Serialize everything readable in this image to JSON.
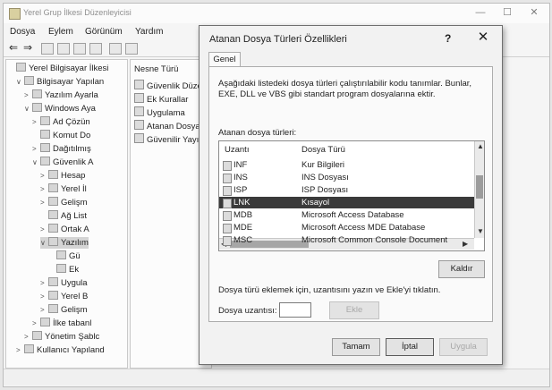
{
  "main_window": {
    "title": "Yerel Grup İlkesi Düzenleyicisi",
    "controls": {
      "minimize": "—",
      "maximize": "☐",
      "close": "✕"
    }
  },
  "menubar": [
    "Dosya",
    "Eylem",
    "Görünüm",
    "Yardım"
  ],
  "tree": [
    {
      "label": "Yerel Bilgisayar İlkesi",
      "arrow": "",
      "depth": 0
    },
    {
      "label": "Bilgisayar Yapılan",
      "arrow": "∨",
      "depth": 1
    },
    {
      "label": "Yazılım Ayarla",
      "arrow": ">",
      "depth": 2
    },
    {
      "label": "Windows Aya",
      "arrow": "∨",
      "depth": 2
    },
    {
      "label": "Ad Çözün",
      "arrow": ">",
      "depth": 3
    },
    {
      "label": "Komut Do",
      "arrow": "",
      "depth": 3
    },
    {
      "label": "Dağıtılmış",
      "arrow": ">",
      "depth": 3
    },
    {
      "label": "Güvenlik A",
      "arrow": "∨",
      "depth": 3
    },
    {
      "label": "Hesap",
      "arrow": ">",
      "depth": 4
    },
    {
      "label": "Yerel İl",
      "arrow": ">",
      "depth": 4
    },
    {
      "label": "Gelişm",
      "arrow": ">",
      "depth": 4
    },
    {
      "label": "Ağ List",
      "arrow": "",
      "depth": 4
    },
    {
      "label": "Ortak A",
      "arrow": ">",
      "depth": 4
    },
    {
      "label": "Yazılım",
      "arrow": "∨",
      "depth": 4,
      "selected": true
    },
    {
      "label": "Gü",
      "arrow": "",
      "depth": 5
    },
    {
      "label": "Ek",
      "arrow": "",
      "depth": 5
    },
    {
      "label": "Uygula",
      "arrow": ">",
      "depth": 4
    },
    {
      "label": "Yerel B",
      "arrow": ">",
      "depth": 4
    },
    {
      "label": "Gelişm",
      "arrow": ">",
      "depth": 4
    },
    {
      "label": "İlke tabanl",
      "arrow": ">",
      "depth": 3
    },
    {
      "label": "Yönetim Şablc",
      "arrow": ">",
      "depth": 2
    },
    {
      "label": "Kullanıcı Yapıland",
      "arrow": ">",
      "depth": 1
    }
  ],
  "list_pane": {
    "header": "Nesne Türü",
    "items": [
      "Güvenlik Düzey",
      "Ek Kurallar",
      "Uygulama",
      "Atanan Dosya T",
      "Güvenilir Yayın"
    ]
  },
  "dialog": {
    "title": "Atanan Dosya Türleri Özellikleri",
    "help": "?",
    "close": "✕",
    "tab": "Genel",
    "description": "Aşağıdaki listedeki dosya türleri çalıştırılabilir kodu tanımlar. Bunlar, EXE, DLL ve VBS gibi standart program dosyalarına ektir.",
    "filetypes_label": "Atanan dosya türleri:",
    "columns": [
      "Uzantı",
      "Dosya Türü"
    ],
    "rows": [
      {
        "ext": "INF",
        "type": "Kur Bilgileri"
      },
      {
        "ext": "INS",
        "type": "INS Dosyası"
      },
      {
        "ext": "ISP",
        "type": "ISP Dosyası"
      },
      {
        "ext": "LNK",
        "type": "Kısayol",
        "selected": true
      },
      {
        "ext": "MDB",
        "type": "Microsoft Access Database"
      },
      {
        "ext": "MDE",
        "type": "Microsoft Access MDE Database"
      },
      {
        "ext": "MSC",
        "type": "Microsoft Common Console Document"
      }
    ],
    "remove_button": "Kaldır",
    "hint": "Dosya türü eklemek için, uzantısını yazın ve Ekle'yi tıklatın.",
    "ext_label": "Dosya uzantısı:",
    "ext_value": "",
    "add_button": "Ekle",
    "ok_button": "Tamam",
    "cancel_button": "İptal",
    "apply_button": "Uygula"
  }
}
